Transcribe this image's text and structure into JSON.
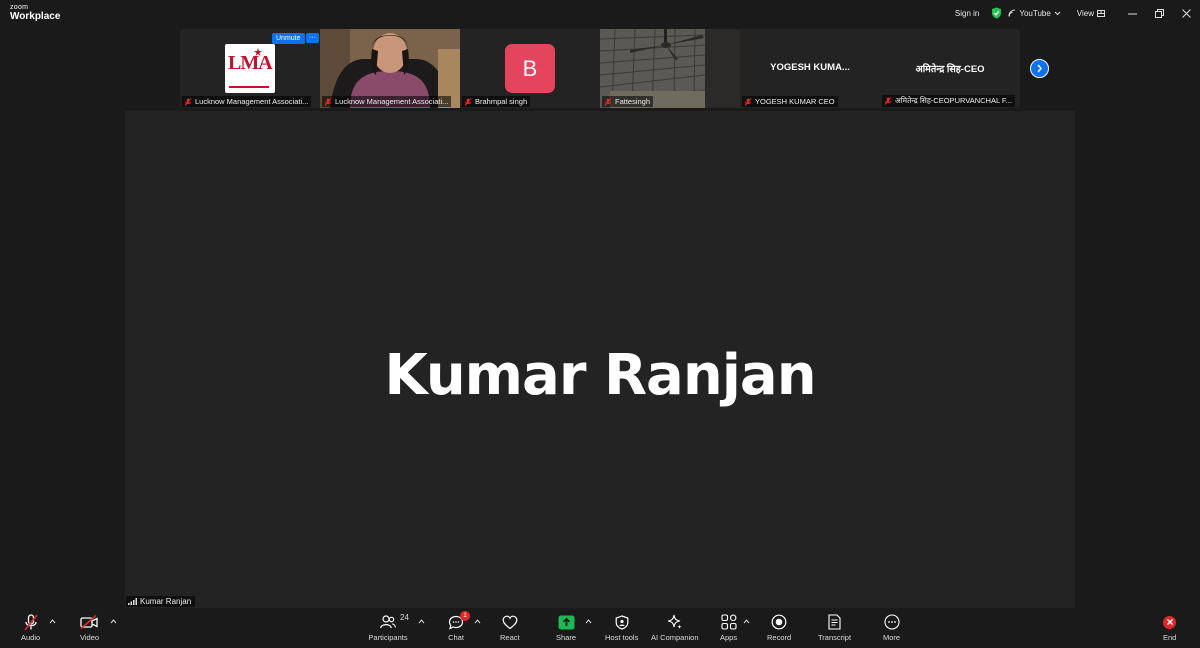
{
  "app": {
    "brand_small": "zoom",
    "brand_name": "Workplace"
  },
  "titlebar": {
    "signin_label": "Sign in",
    "stream_label": "YouTube",
    "view_label": "View"
  },
  "thumbnails": [
    {
      "name": "Lucknow Management Associati...",
      "logo_text": "LMA",
      "unmute_label": "Unmute",
      "more_label": "···"
    },
    {
      "name": "Lucknow Management Associati..."
    },
    {
      "name": "Brahmpal singh",
      "avatar_letter": "B"
    },
    {
      "name": "Fattesingh"
    },
    {
      "name": "YOGESH KUMAR CEO",
      "display": "YOGESH  KUMA..."
    },
    {
      "name": "अमितेन्द्र सिह-CEOPURVANCHAL F...",
      "display": "अमितेन्द्र सिह-CEO"
    }
  ],
  "main": {
    "speaker_name": "Kumar Ranjan",
    "namebar_label": "Kumar Ranjan"
  },
  "toolbar": {
    "audio_label": "Audio",
    "video_label": "Video",
    "participants_label": "Participants",
    "participants_count": "24",
    "chat_label": "Chat",
    "chat_badge": "1",
    "react_label": "React",
    "share_label": "Share",
    "host_tools_label": "Host tools",
    "ai_label": "AI Companion",
    "apps_label": "Apps",
    "record_label": "Record",
    "transcript_label": "Transcript",
    "more_label": "More",
    "end_label": "End"
  },
  "colors": {
    "accent": "#0e72ed",
    "end": "#e02828",
    "avatar_b": "#e5445f",
    "share": "#1db954"
  }
}
